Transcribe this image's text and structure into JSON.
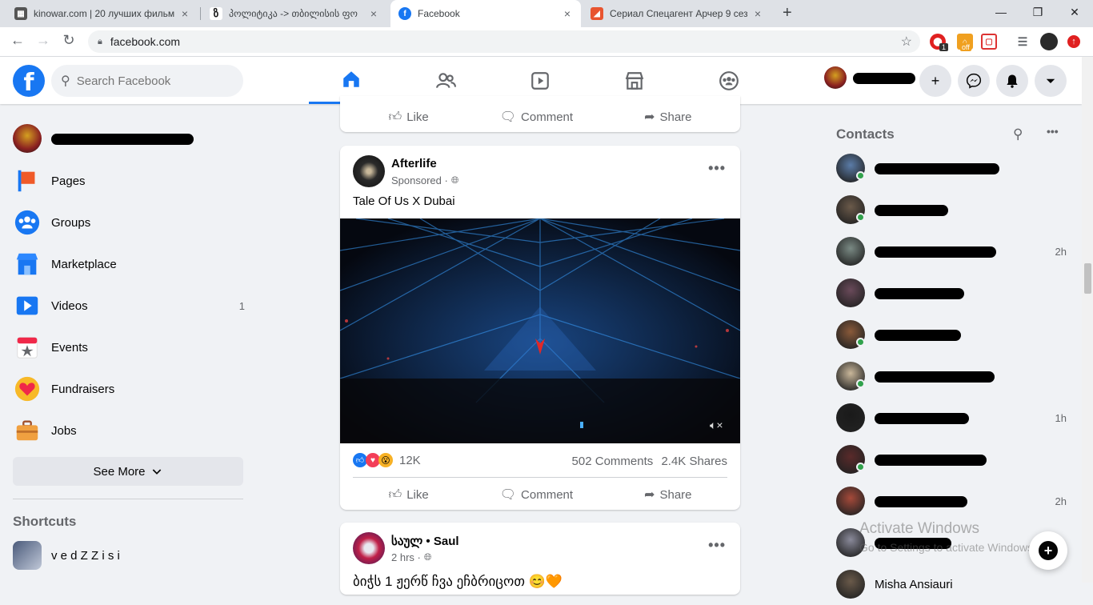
{
  "browser": {
    "tabs": [
      {
        "title": "kinowar.com | 20 лучших фильм",
        "favicon_color": "#555555"
      },
      {
        "title": "პოლიტიკა -> თბილისის ფო",
        "favicon_color": "#1a1a1a"
      },
      {
        "title": "Facebook",
        "favicon_color": "#1877f2"
      },
      {
        "title": "Сериал Спецагент Арчер 9 сезо",
        "favicon_color": "#e8542f"
      }
    ],
    "tab_close": "×",
    "new_tab": "+",
    "url": "facebook.com",
    "window_controls": [
      "—",
      "❐",
      "✕"
    ],
    "extension_badges": {
      "notif_count": "1",
      "off_label": "off"
    }
  },
  "fb_header": {
    "logo_letter": "f",
    "search_placeholder": "Search Facebook",
    "nav_tabs": [
      "home",
      "friends",
      "watch",
      "marketplace",
      "groups"
    ],
    "create_icon": "+",
    "brand_color": "#1877f2"
  },
  "left_nav": {
    "items": [
      {
        "label": "Pages",
        "icon": "flag-icon",
        "count": ""
      },
      {
        "label": "Groups",
        "icon": "groups-icon",
        "count": ""
      },
      {
        "label": "Marketplace",
        "icon": "shop-icon",
        "count": ""
      },
      {
        "label": "Videos",
        "icon": "video-icon",
        "count": "1"
      },
      {
        "label": "Events",
        "icon": "calendar-star-icon",
        "count": ""
      },
      {
        "label": "Fundraisers",
        "icon": "heart-icon",
        "count": ""
      },
      {
        "label": "Jobs",
        "icon": "briefcase-icon",
        "count": ""
      }
    ],
    "see_more": "See More",
    "shortcuts_title": "Shortcuts",
    "shortcut_item": "v e d Z Z i s i"
  },
  "feed": {
    "actions": {
      "like": "Like",
      "comment": "Comment",
      "share": "Share"
    },
    "post1": {
      "author": "Afterlife",
      "meta": "Sponsored ·",
      "caption_a": "Tale Of Us",
      "caption_b": " X Dubai",
      "reactions_count": "12K",
      "comments": "502 Comments",
      "shares": "2.4K Shares"
    },
    "post2": {
      "author": "საულ • Saul",
      "meta": "2 hrs ·",
      "caption": "ბიჭს 1 ჟერწ ჩვა  ეჩბრიცოთ  😊🧡"
    }
  },
  "contacts": {
    "title": "Contacts",
    "items": [
      {
        "time": "",
        "online": true,
        "color": "#5b7ca8"
      },
      {
        "time": "",
        "online": true,
        "color": "#6b5a4a"
      },
      {
        "time": "2h",
        "online": false,
        "color": "#7a8a84"
      },
      {
        "time": "",
        "online": false,
        "color": "#6a4a5a"
      },
      {
        "time": "",
        "online": true,
        "color": "#8a5a3a"
      },
      {
        "time": "",
        "online": true,
        "color": "#c9b79a"
      },
      {
        "time": "1h",
        "online": false,
        "color": "#1a1a1a"
      },
      {
        "time": "",
        "online": true,
        "color": "#5a2a2a"
      },
      {
        "time": "2h",
        "online": false,
        "color": "#a64a3a"
      },
      {
        "time": "",
        "online": false,
        "color": "#8a8a9a"
      },
      {
        "time": "",
        "online": false,
        "color": "#6a5a4a",
        "name_partial": "Misha Ansiauri"
      }
    ]
  },
  "watermark": {
    "line1": "Activate Windows",
    "line2": "Go to Settings to activate Windows."
  }
}
